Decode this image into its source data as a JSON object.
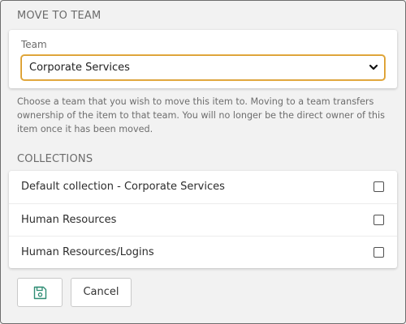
{
  "move_to_team": {
    "section_title": "MOVE TO TEAM",
    "team_label": "Team",
    "team_selected": "Corporate Services",
    "help_text": "Choose a team that you wish to move this item to. Moving to a team transfers ownership of the item to that team. You will no longer be the direct owner of this item once it has been moved."
  },
  "collections": {
    "section_title": "COLLECTIONS",
    "items": [
      {
        "label": "Default collection - Corporate Services",
        "checked": false
      },
      {
        "label": "Human Resources",
        "checked": false
      },
      {
        "label": "Human Resources/Logins",
        "checked": false
      }
    ]
  },
  "actions": {
    "save_icon": "floppy-disk-icon",
    "cancel_label": "Cancel"
  },
  "colors": {
    "select_focus_border": "#d89a2a",
    "save_icon": "#2f8d74"
  }
}
